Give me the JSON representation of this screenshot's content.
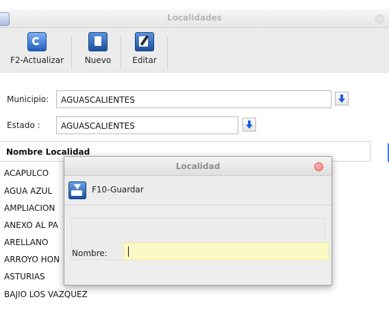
{
  "window": {
    "title": "Localidades"
  },
  "toolbar": {
    "refresh_label": "F2-Actualizar",
    "new_label": "Nuevo",
    "edit_label": "Editar"
  },
  "filters": {
    "municipio_label": "Municipio:",
    "municipio_value": "AGUASCALIENTES",
    "estado_label": "Estado :",
    "estado_value": "AGUASCALIENTES"
  },
  "table": {
    "header": "Nombre Localidad",
    "rows": [
      "ACAPULCO",
      "AGUA AZUL",
      "AMPLIACION",
      "ANEXO AL PA",
      "ARELLANO",
      "ARROYO HON",
      "ASTURIAS",
      "BAJIO LOS VAZQUEZ"
    ]
  },
  "dialog": {
    "title": "Localidad",
    "save_label": "F10-Guardar",
    "nombre_label": "Nombre:",
    "nombre_value": ""
  }
}
